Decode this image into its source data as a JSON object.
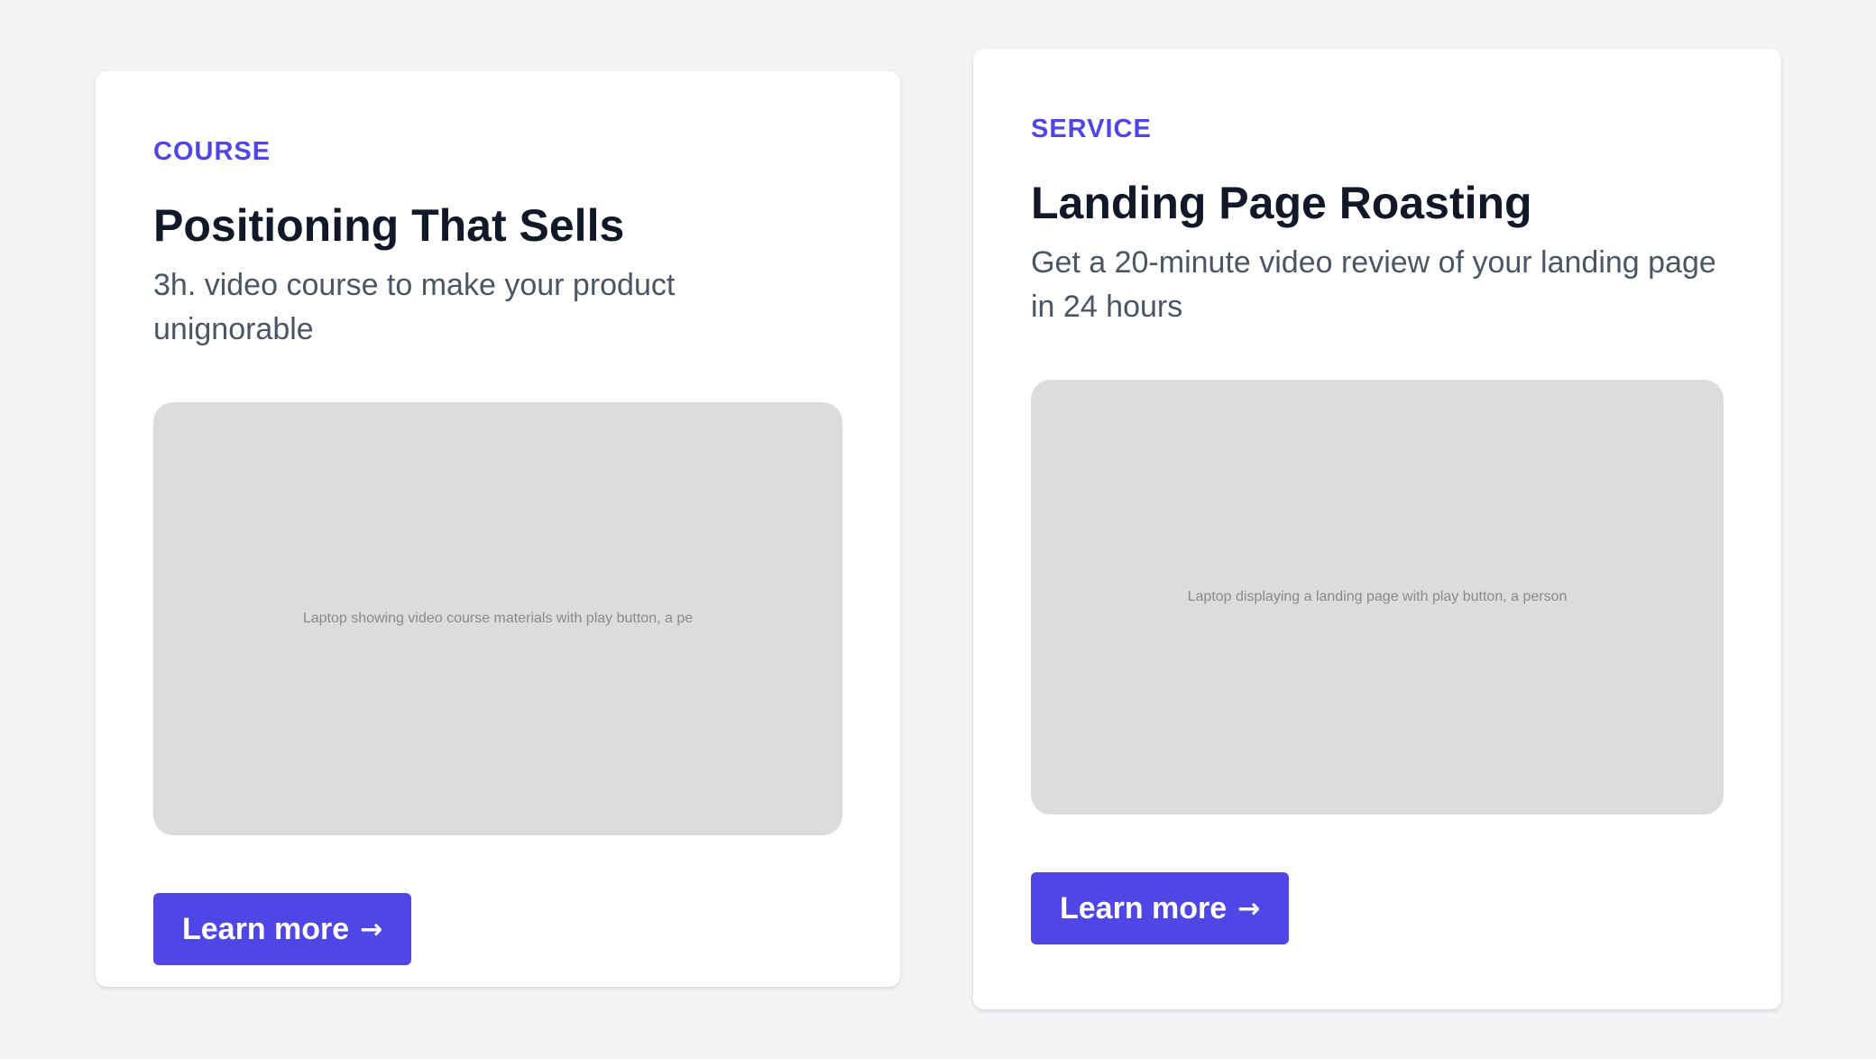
{
  "cards": [
    {
      "category": "COURSE",
      "title": "Positioning That Sells",
      "description": "3h. video course to make your product unignorable",
      "image_alt": "Laptop showing video course materials with play button, a pe",
      "cta_label": "Learn more",
      "cta_arrow": "→"
    },
    {
      "category": "SERVICE",
      "title": "Landing Page Roasting",
      "description": "Get a 20-minute video review of your landing page in 24 hours",
      "image_alt": "Laptop displaying a landing page with play button, a person",
      "cta_label": "Learn more",
      "cta_arrow": "→"
    }
  ],
  "colors": {
    "accent": "#4f46e5",
    "background": "#f3f4f6",
    "card": "#ffffff",
    "title": "#111827",
    "body_text": "#4b5563",
    "placeholder": "#dcdcdc"
  }
}
